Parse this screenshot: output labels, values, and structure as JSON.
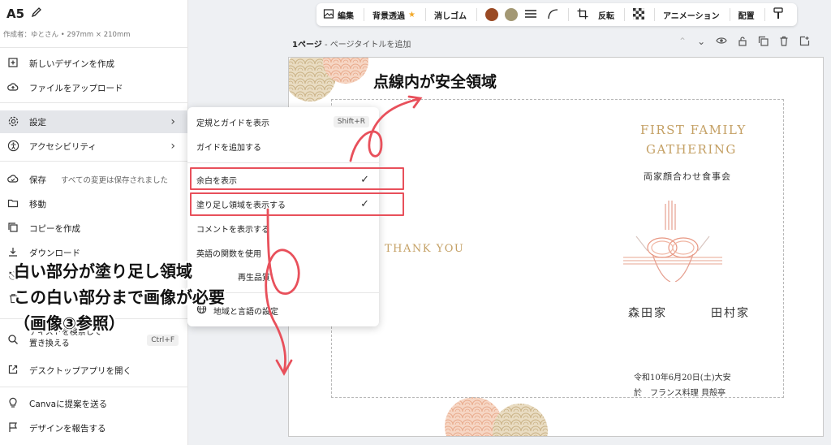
{
  "doc": {
    "title": "A5",
    "subtitle": "作成者：ゆとさん • 297mm × 210mm"
  },
  "left_menu": {
    "new_design": "新しいデザインを作成",
    "upload": "ファイルをアップロード",
    "settings": "設定",
    "accessibility": "アクセシビリティ",
    "save": "保存",
    "save_status": "すべての変更は保存されました",
    "move": "移動",
    "copy": "コピーを作成",
    "download": "ダウンロード",
    "find_replace": "テキストを検索して置き換える",
    "find_shortcut": "Ctrl+F",
    "desktop_app": "デスクトップアプリを開く",
    "suggest": "Canvaに提案を送る",
    "report": "デザインを報告する"
  },
  "toolbar": {
    "edit": "編集",
    "bg_remove": "背景透過",
    "eraser": "消しゴム",
    "flip": "反転",
    "animation": "アニメーション",
    "arrange": "配置",
    "colors": [
      "#9a4a24",
      "#a39874"
    ]
  },
  "page": {
    "number": "1ページ",
    "title_placeholder": " - ページタイトルを追加"
  },
  "submenu": {
    "rulers": "定規とガイドを表示",
    "rulers_shortcut": "Shift+R",
    "add_guides": "ガイドを追加する",
    "show_margins": "余白を表示",
    "show_bleed": "塗り足し領域を表示する",
    "show_comments": "コメントを表示する",
    "english_fn": "英語の関数を使用",
    "playback": "再生品質",
    "region": "地域と言語の設定"
  },
  "design": {
    "headline_1": "FIRST FAMILY",
    "headline_2": "GATHERING",
    "subtitle": "両家顔合わせ食事会",
    "thank_you": "THANK YOU",
    "family_left": "森田家",
    "family_right": "田村家",
    "date_line": "令和10年6月20日(土)大安",
    "venue_line": "於　フランス料理 貝殻亭"
  },
  "annotations": {
    "safe_zone": "点線内が安全領域",
    "white_part": "白い部分が塗り足し領域",
    "needs_image": "この白い部分まで画像が必要",
    "see_image": "（画像③参照）"
  }
}
